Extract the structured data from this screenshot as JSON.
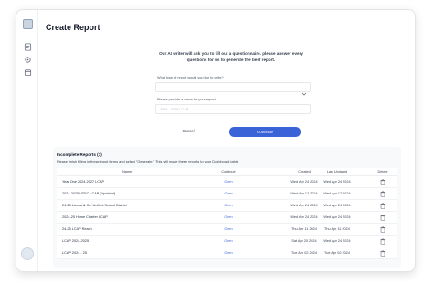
{
  "page": {
    "title": "Create Report"
  },
  "form": {
    "intro": "Our AI writer will ask you to fill out a questionnaire. please answer every questions for us to generate the best report.",
    "type_label": "What type of report would you like to write?",
    "type_value": "",
    "name_label": "Please provide a name for your report",
    "name_placeholder": "2024 - 2025 LCAP",
    "cancel_label": "Cancel",
    "continue_label": "Continue"
  },
  "incomplete": {
    "title": "Incomplete Reports (7)",
    "subtitle": "Please finish filling in these input forms and select \"Generate.\" This will move these reports to your Dashboard table",
    "columns": {
      "name": "Name",
      "continue": "Continue",
      "created": "Created",
      "updated": "Last Updated",
      "delete": "Delete"
    },
    "rows": [
      {
        "name": "Year One 2024-2027 LCAP",
        "action": "Open",
        "created": "Wed Apr 24 2024",
        "updated": "Wed Apr 24 2024"
      },
      {
        "name": "2024-2025 VTEC LCAP (Updated)",
        "action": "Open",
        "created": "Wed Apr 17 2024",
        "updated": "Wed Apr 17 2024"
      },
      {
        "name": "24-25 Licona & Co. Unified School District",
        "action": "Open",
        "created": "Wed Apr 24 2024",
        "updated": "Wed Apr 24 2024"
      },
      {
        "name": "2024-25 Home Charter LCAP",
        "action": "Open",
        "created": "Wed Apr 24 2024",
        "updated": "Wed Apr 24 2024"
      },
      {
        "name": "24-25 LCAP Reach",
        "action": "Open",
        "created": "Thu Apr 11 2024",
        "updated": "Thu Apr 11 2024"
      },
      {
        "name": "LCAP 2024-2025",
        "action": "Open",
        "created": "Sat Apr 20 2024",
        "updated": "Wed Apr 24 2024"
      },
      {
        "name": "LCAP 2024 - 25",
        "action": "Open",
        "created": "Tue Apr 02 2024",
        "updated": "Tue Apr 02 2024"
      }
    ]
  },
  "icons": {
    "rail": [
      "logo-icon",
      "report-icon",
      "settings-icon",
      "calendar-icon"
    ],
    "row_delete": "trash-icon",
    "select_chevron": "chevron-down-icon"
  },
  "colors": {
    "accent": "#3b63d8",
    "panel_bg": "#f8f9fa"
  }
}
